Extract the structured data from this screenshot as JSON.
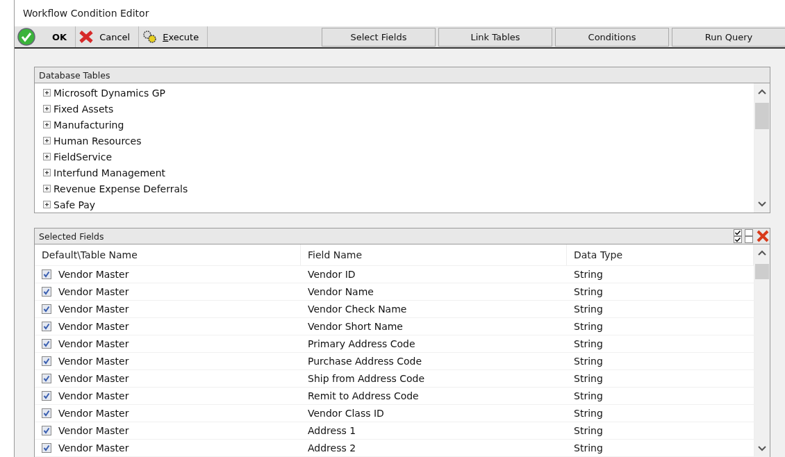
{
  "window": {
    "title": "Workflow Condition Editor"
  },
  "toolbar": {
    "actions": [
      {
        "kind": "ok",
        "label": "OK"
      },
      {
        "kind": "cancel",
        "label": "Cancel"
      },
      {
        "kind": "execute",
        "label": "Execute"
      }
    ],
    "tabs": [
      "Select Fields",
      "Link Tables",
      "Conditions",
      "Run Query"
    ]
  },
  "database_tables": {
    "title": "Database Tables",
    "items": [
      {
        "label": "Microsoft Dynamics GP",
        "expanded": false
      },
      {
        "label": "Fixed Assets",
        "expanded": false
      },
      {
        "label": "Manufacturing",
        "expanded": false
      },
      {
        "label": "Human Resources",
        "expanded": false
      },
      {
        "label": "FieldService",
        "expanded": false
      },
      {
        "label": "Interfund Management",
        "expanded": false
      },
      {
        "label": "Revenue Expense Deferrals",
        "expanded": false
      },
      {
        "label": "Safe Pay",
        "expanded": false
      }
    ]
  },
  "selected_fields": {
    "title": "Selected Fields",
    "columns": [
      "Default\\Table Name",
      "Field Name",
      "Data Type"
    ],
    "rows": [
      {
        "checked": true,
        "table": "Vendor Master",
        "field": "Vendor ID",
        "type": "String"
      },
      {
        "checked": true,
        "table": "Vendor Master",
        "field": "Vendor Name",
        "type": "String"
      },
      {
        "checked": true,
        "table": "Vendor Master",
        "field": "Vendor Check Name",
        "type": "String"
      },
      {
        "checked": true,
        "table": "Vendor Master",
        "field": "Vendor Short Name",
        "type": "String"
      },
      {
        "checked": true,
        "table": "Vendor Master",
        "field": "Primary Address Code",
        "type": "String"
      },
      {
        "checked": true,
        "table": "Vendor Master",
        "field": "Purchase Address Code",
        "type": "String"
      },
      {
        "checked": true,
        "table": "Vendor Master",
        "field": "Ship from Address Code",
        "type": "String"
      },
      {
        "checked": true,
        "table": "Vendor Master",
        "field": "Remit to Address Code",
        "type": "String"
      },
      {
        "checked": true,
        "table": "Vendor Master",
        "field": "Vendor Class ID",
        "type": "String"
      },
      {
        "checked": true,
        "table": "Vendor Master",
        "field": "Address 1",
        "type": "String"
      },
      {
        "checked": true,
        "table": "Vendor Master",
        "field": "Address 2",
        "type": "String"
      }
    ]
  }
}
